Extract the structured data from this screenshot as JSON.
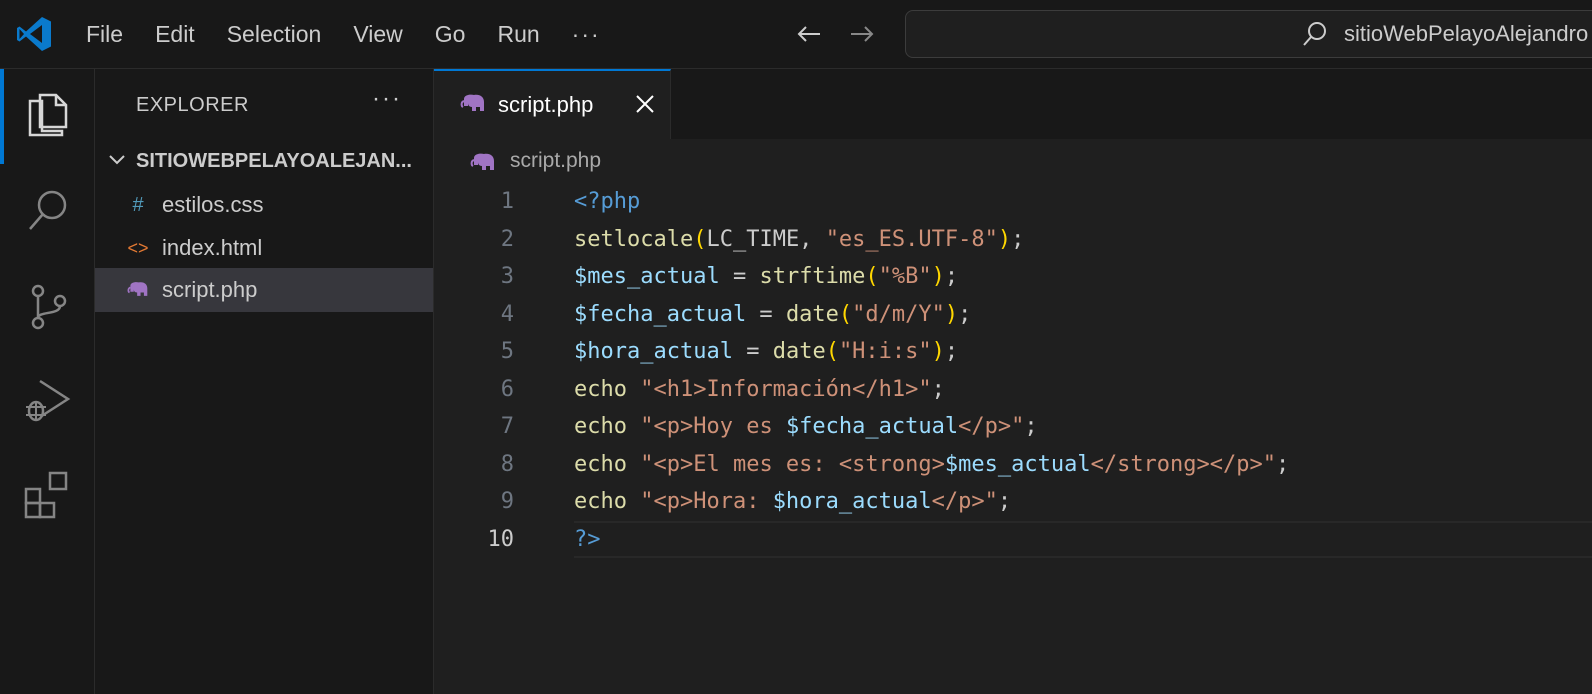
{
  "titlebar": {
    "menu": [
      "File",
      "Edit",
      "Selection",
      "View",
      "Go",
      "Run"
    ],
    "more": "···",
    "search_text": "sitioWebPelayoAlejandro"
  },
  "explorer": {
    "title": "EXPLORER",
    "more": "···",
    "folder": "SITIOWEBPELAYOALEJAN...",
    "files": [
      {
        "name": "estilos.css",
        "icon": "#",
        "icon_color": "#519aba"
      },
      {
        "name": "index.html",
        "icon": "<>",
        "icon_color": "#e37933"
      },
      {
        "name": "script.php",
        "icon": "php-elephant",
        "icon_color": "#a074c4",
        "active": true
      }
    ]
  },
  "editor": {
    "tab_label": "script.php",
    "breadcrumb": "script.php",
    "current_line": 10,
    "lines": [
      {
        "n": "1",
        "tokens": [
          [
            "tag",
            "<?php"
          ]
        ]
      },
      {
        "n": "2",
        "tokens": [
          [
            "fn",
            "setlocale"
          ],
          [
            "paren",
            "("
          ],
          [
            "plain",
            "LC_TIME, "
          ],
          [
            "str",
            "\"es_ES.UTF-8\""
          ],
          [
            "paren",
            ")"
          ],
          [
            "plain",
            ";"
          ]
        ]
      },
      {
        "n": "3",
        "tokens": [
          [
            "var",
            "$mes_actual"
          ],
          [
            "plain",
            " = "
          ],
          [
            "fn",
            "strftime"
          ],
          [
            "paren",
            "("
          ],
          [
            "str",
            "\"%B\""
          ],
          [
            "paren",
            ")"
          ],
          [
            "plain",
            ";"
          ]
        ]
      },
      {
        "n": "4",
        "tokens": [
          [
            "var",
            "$fecha_actual"
          ],
          [
            "plain",
            " = "
          ],
          [
            "fn",
            "date"
          ],
          [
            "paren",
            "("
          ],
          [
            "str",
            "\"d/m/Y\""
          ],
          [
            "paren",
            ")"
          ],
          [
            "plain",
            ";"
          ]
        ]
      },
      {
        "n": "5",
        "tokens": [
          [
            "var",
            "$hora_actual"
          ],
          [
            "plain",
            " = "
          ],
          [
            "fn",
            "date"
          ],
          [
            "paren",
            "("
          ],
          [
            "str",
            "\"H:i:s\""
          ],
          [
            "paren",
            ")"
          ],
          [
            "plain",
            ";"
          ]
        ]
      },
      {
        "n": "6",
        "tokens": [
          [
            "kw",
            "echo"
          ],
          [
            "plain",
            " "
          ],
          [
            "str",
            "\"<h1>Información</h1>\""
          ],
          [
            "plain",
            ";"
          ]
        ]
      },
      {
        "n": "7",
        "tokens": [
          [
            "kw",
            "echo"
          ],
          [
            "plain",
            " "
          ],
          [
            "str",
            "\"<p>Hoy es "
          ],
          [
            "var",
            "$fecha_actual"
          ],
          [
            "str",
            "</p>\""
          ],
          [
            "plain",
            ";"
          ]
        ]
      },
      {
        "n": "8",
        "tokens": [
          [
            "kw",
            "echo"
          ],
          [
            "plain",
            " "
          ],
          [
            "str",
            "\"<p>El mes es: <strong>"
          ],
          [
            "var",
            "$mes_actual"
          ],
          [
            "str",
            "</strong></p>\""
          ],
          [
            "plain",
            ";"
          ]
        ]
      },
      {
        "n": "9",
        "tokens": [
          [
            "kw",
            "echo"
          ],
          [
            "plain",
            " "
          ],
          [
            "str",
            "\"<p>Hora: "
          ],
          [
            "var",
            "$hora_actual"
          ],
          [
            "str",
            "</p>\""
          ],
          [
            "plain",
            ";"
          ]
        ]
      },
      {
        "n": "10",
        "tokens": [
          [
            "tag",
            "?>"
          ]
        ]
      }
    ]
  },
  "colors": {
    "accent": "#0078d4",
    "php_icon": "#a074c4"
  }
}
